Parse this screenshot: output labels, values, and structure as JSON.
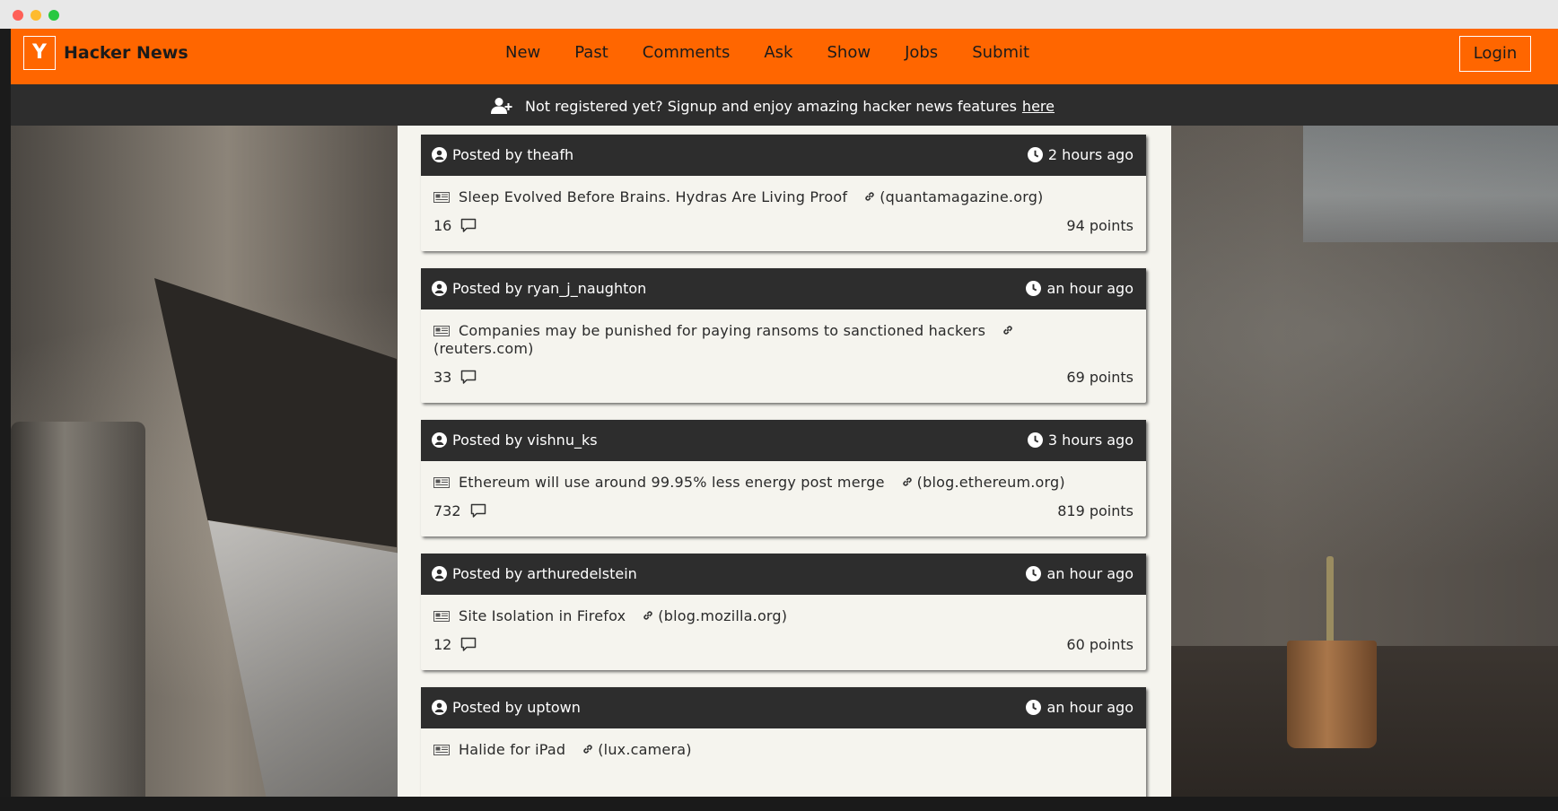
{
  "window": {
    "controls": [
      "close",
      "minimize",
      "maximize"
    ]
  },
  "navbar": {
    "logo_letter": "Y",
    "brand": "Hacker News",
    "links": [
      "New",
      "Past",
      "Comments",
      "Ask",
      "Show",
      "Jobs",
      "Submit"
    ],
    "login_label": "Login",
    "accent_color": "#ff6600"
  },
  "signup": {
    "icon": "user-plus-icon",
    "text": "Not registered yet? Signup and enjoy amazing hacker news features",
    "link_text": "here"
  },
  "stories": [
    {
      "author_prefix": "Posted by",
      "author": "theafh",
      "time": "2 hours ago",
      "title": "Sleep Evolved Before Brains. Hydras Are Living Proof",
      "domain": "(quantamagazine.org)",
      "comments": "16",
      "points": "94 points"
    },
    {
      "author_prefix": "Posted by",
      "author": "ryan_j_naughton",
      "time": "an hour ago",
      "title": "Companies may be punished for paying ransoms to sanctioned hackers",
      "domain": "(reuters.com)",
      "comments": "33",
      "points": "69 points"
    },
    {
      "author_prefix": "Posted by",
      "author": "vishnu_ks",
      "time": "3 hours ago",
      "title": "Ethereum will use around 99.95% less energy post merge",
      "domain": "(blog.ethereum.org)",
      "comments": "732",
      "points": "819 points"
    },
    {
      "author_prefix": "Posted by",
      "author": "arthuredelstein",
      "time": "an hour ago",
      "title": "Site Isolation in Firefox",
      "domain": "(blog.mozilla.org)",
      "comments": "12",
      "points": "60 points"
    },
    {
      "author_prefix": "Posted by",
      "author": "uptown",
      "time": "an hour ago",
      "title": "Halide for iPad",
      "domain": "(lux.camera)",
      "comments": "",
      "points": ""
    }
  ]
}
